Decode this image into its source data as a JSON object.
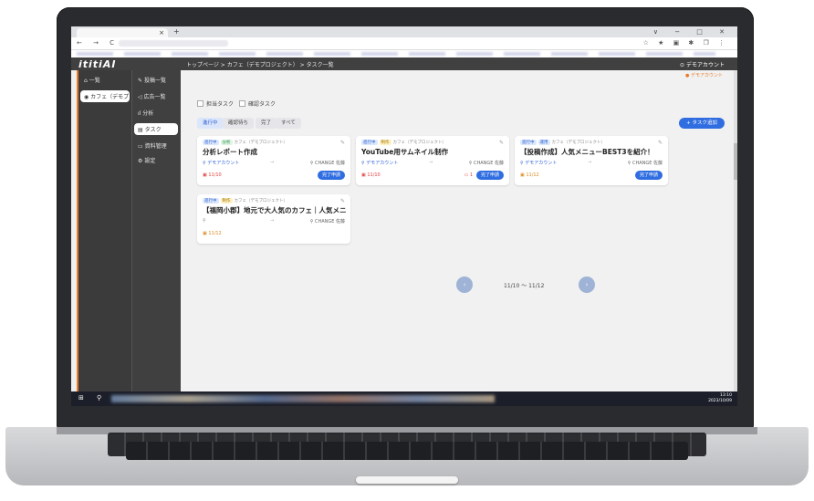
{
  "browser": {
    "tab_title": "",
    "new_tab": "+",
    "window_controls": "∨ − □ ✕",
    "nav_buttons": "← → C ⌂",
    "extensions": "☆ ★ ▣ ✱ ❐ ⋮"
  },
  "header": {
    "logo": "ititiAI",
    "breadcrumb": "トップページ > カフェ（デモプロジェクト） > タスク一覧",
    "account": "デモアカウント",
    "account_sub": "デモアカウント"
  },
  "sidebar_left": {
    "items": [
      {
        "icon": "⌂",
        "label": "一覧"
      },
      {
        "icon": "◉",
        "label": "カフェ（デモプロ..."
      }
    ]
  },
  "sidebar_right": {
    "items": [
      {
        "icon": "✎",
        "label": "投稿一覧"
      },
      {
        "icon": "◁",
        "label": "広告一覧"
      },
      {
        "icon": "ıl",
        "label": "分析"
      },
      {
        "icon": "▤",
        "label": "タスク"
      },
      {
        "icon": "▭",
        "label": "資料管理"
      },
      {
        "icon": "⚙",
        "label": "設定"
      }
    ]
  },
  "filters": {
    "check1": "担当タスク",
    "check2": "確認タスク",
    "buttons": [
      "進行中",
      "確認待ち",
      "完了",
      "すべて"
    ],
    "add_button": "+ タスク追加"
  },
  "cards": [
    {
      "tags": [
        "進行中",
        "分析"
      ],
      "project": "カフェ（デモプロジェクト）",
      "title": "分析レポート作成",
      "account": "デモアカウント",
      "owner": "CHANGE 佐藤",
      "date": "11/10",
      "done": "完了申請"
    },
    {
      "tags": [
        "進行中",
        "制作"
      ],
      "project": "カフェ（デモプロジェクト）",
      "title": "YouTube用サムネイル制作",
      "account": "デモアカウント",
      "owner": "CHANGE 佐藤",
      "date": "11/10",
      "comments": "1",
      "done": "完了申請"
    },
    {
      "tags": [
        "進行中",
        "運用"
      ],
      "project": "カフェ（デモプロジェクト）",
      "title": "【投稿作成】人気メニューBEST3を紹介！",
      "account": "デモアカウント",
      "owner": "CHANGE 佐藤",
      "date": "11/12",
      "done": "完了申請"
    },
    {
      "tags": [
        "進行中",
        "制作"
      ],
      "project": "カフェ（デモプロジェクト）",
      "title": "【福岡小郡】地元で大人気のカフェ｜人気メニューBE...",
      "account": "",
      "owner": "CHANGE 佐藤",
      "date": "11/12",
      "done": ""
    }
  ],
  "pager": {
    "prev": "‹",
    "next": "›",
    "range": "11/10 〜 11/12"
  },
  "taskbar": {
    "time": "13:10",
    "date": "2023/10/09"
  },
  "colors": {
    "accent": "#2f6de0",
    "sidebar": "#404040",
    "brand_orange": "#e87b2a"
  }
}
